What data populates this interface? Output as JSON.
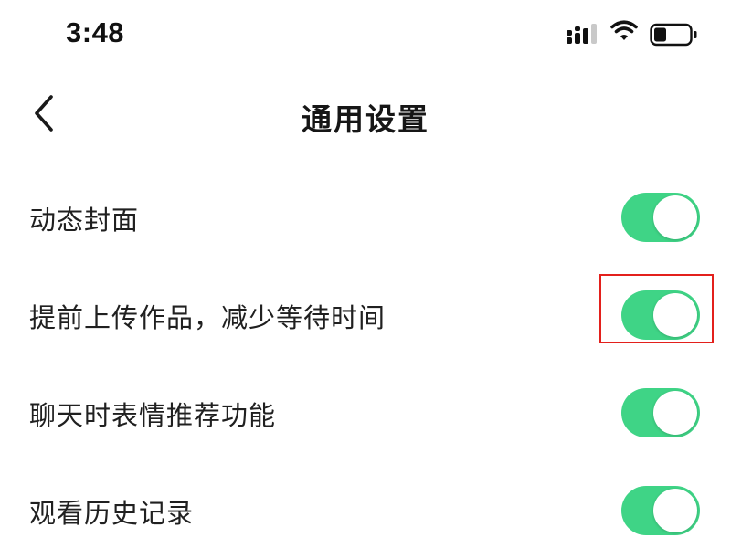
{
  "status_bar": {
    "time": "3:48",
    "icons": [
      "signal-icon",
      "wifi-icon",
      "battery-icon"
    ]
  },
  "nav": {
    "back_icon": "chevron-left-icon",
    "title": "通用设置"
  },
  "colors": {
    "toggle_on": "#3fd486",
    "highlight": "#e3201c"
  },
  "settings": [
    {
      "label": "动态封面",
      "enabled": true
    },
    {
      "label": "提前上传作品，减少等待时间",
      "enabled": true,
      "highlighted": true
    },
    {
      "label": "聊天时表情推荐功能",
      "enabled": true
    },
    {
      "label": "观看历史记录",
      "enabled": true
    }
  ]
}
